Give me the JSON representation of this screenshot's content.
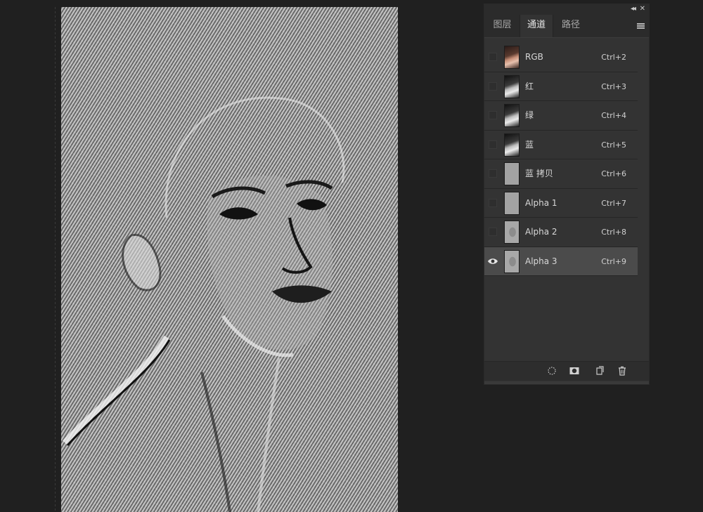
{
  "panel": {
    "controls": {
      "collapse": "◂◂",
      "close": "✕"
    },
    "tabs": [
      {
        "label": "图层",
        "active": false
      },
      {
        "label": "通道",
        "active": true
      },
      {
        "label": "路径",
        "active": false
      }
    ],
    "channels": [
      {
        "name": "RGB",
        "shortcut": "Ctrl+2",
        "thumb": "color",
        "visible": false,
        "active": false
      },
      {
        "name": "红",
        "shortcut": "Ctrl+3",
        "thumb": "gray",
        "visible": false,
        "active": false
      },
      {
        "name": "绿",
        "shortcut": "Ctrl+4",
        "thumb": "gray",
        "visible": false,
        "active": false
      },
      {
        "name": "蓝",
        "shortcut": "Ctrl+5",
        "thumb": "gray",
        "visible": false,
        "active": false
      },
      {
        "name": "蓝 拷贝",
        "shortcut": "Ctrl+6",
        "thumb": "mask",
        "visible": false,
        "active": false
      },
      {
        "name": "Alpha 1",
        "shortcut": "Ctrl+7",
        "thumb": "mask",
        "visible": false,
        "active": false
      },
      {
        "name": "Alpha 2",
        "shortcut": "Ctrl+8",
        "thumb": "mask2",
        "visible": false,
        "active": false
      },
      {
        "name": "Alpha 3",
        "shortcut": "Ctrl+9",
        "thumb": "mask2",
        "visible": true,
        "active": true
      }
    ],
    "bottom_icons": [
      "load-selection-icon",
      "save-selection-mask-icon",
      "new-channel-icon",
      "trash-icon"
    ]
  },
  "colors": {
    "background": "#202020",
    "panel": "#333333",
    "active_row": "#4b4b4b",
    "text": "#d8d8d8"
  }
}
